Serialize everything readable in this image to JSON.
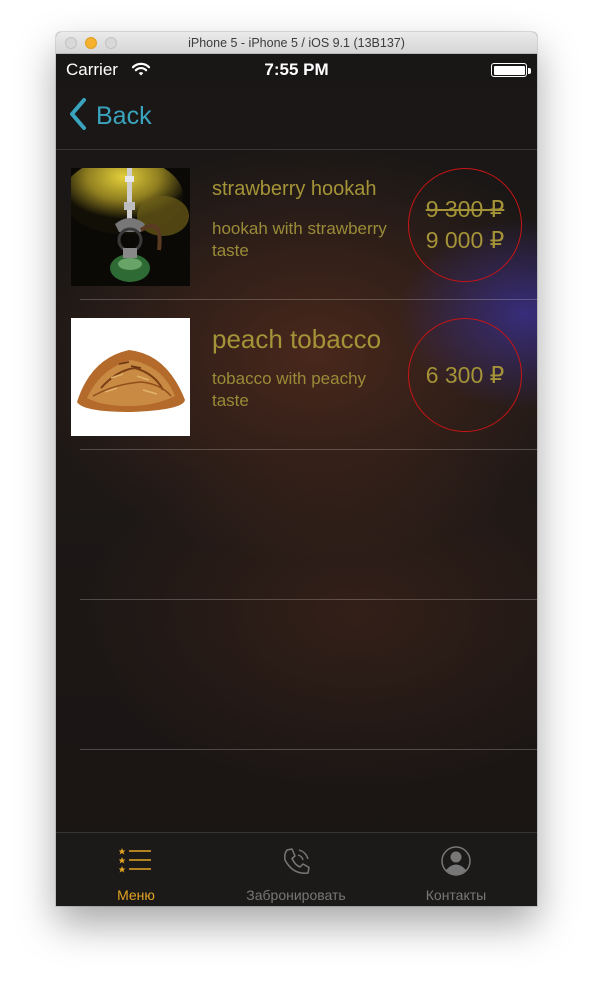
{
  "window": {
    "title": "iPhone 5 - iPhone 5 / iOS 9.1 (13B137)"
  },
  "status_bar": {
    "carrier": "Carrier",
    "time": "7:55 PM"
  },
  "nav": {
    "back_label": "Back"
  },
  "items": [
    {
      "name": "strawberry hookah",
      "description": "hookah with strawberry taste",
      "old_price": "9 300 ₽",
      "price": "9 000 ₽",
      "image_icon": "hookah-image"
    },
    {
      "name": "peach tobacco",
      "description": "tobacco with peachy taste",
      "price": "6 300 ₽",
      "image_icon": "tobacco-image"
    }
  ],
  "tab_bar": {
    "tabs": [
      {
        "label": "Меню",
        "icon": "menu-list-icon",
        "active": true
      },
      {
        "label": "Забронировать",
        "icon": "phone-icon",
        "active": false
      },
      {
        "label": "Контакты",
        "icon": "contact-icon",
        "active": false
      }
    ]
  },
  "colors": {
    "accent_blue": "#3aa4bf",
    "text_gold": "#a49337",
    "price_circle_red": "#c81515",
    "tab_active": "#e4a422"
  }
}
